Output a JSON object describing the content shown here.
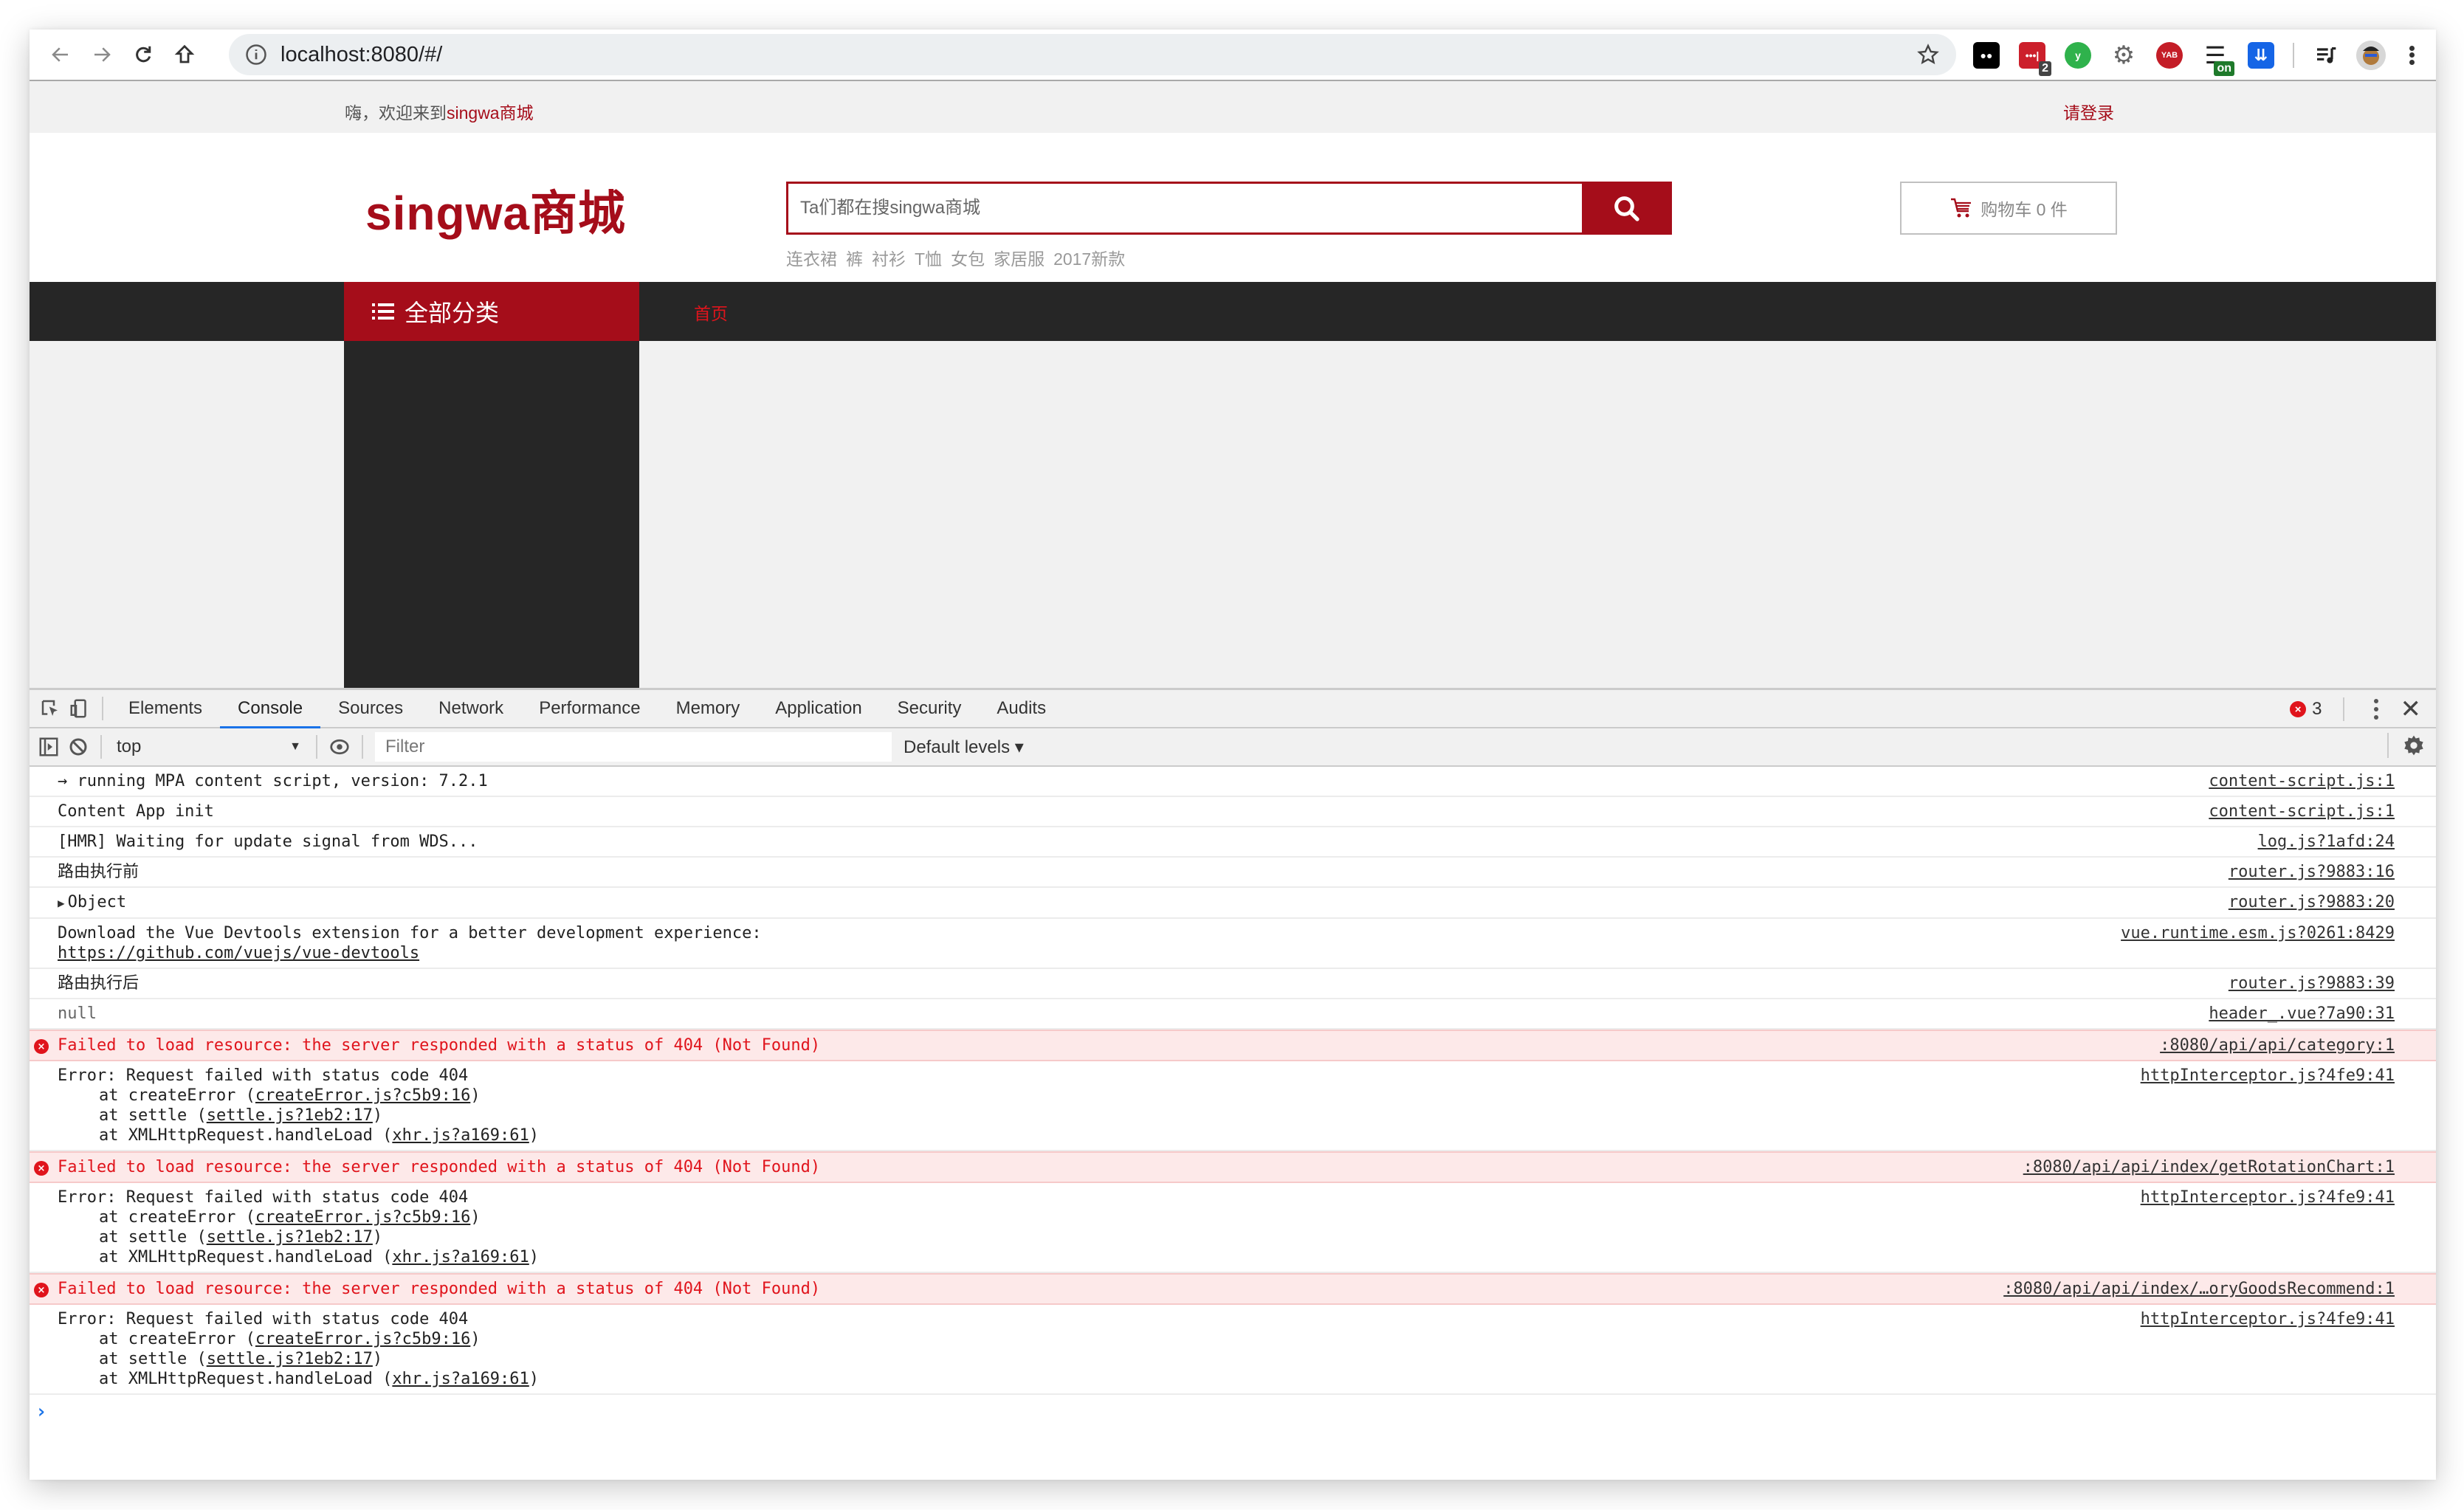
{
  "browser": {
    "url": "localhost:8080/#/",
    "nav_icons": [
      "back-icon",
      "forward-icon",
      "reload-icon",
      "home-icon"
    ],
    "extensions": [
      {
        "name": "tampermonkey-extension",
        "label": "●●",
        "color": "#000000"
      },
      {
        "name": "lastpass-extension",
        "label": "•••|",
        "color": "#cc1f2b",
        "badge": "2",
        "badge_color": "#444444"
      },
      {
        "name": "vimium-extension",
        "label": "y",
        "color": "#2fb24c"
      },
      {
        "name": "settings-gear-extension",
        "label": "⚙",
        "color": "#666666"
      },
      {
        "name": "yab-extension",
        "label": "YAB",
        "color": "#c41d27"
      },
      {
        "name": "list-extension",
        "label": "☰",
        "color": "#222222",
        "badge": "on",
        "badge_color": "#1f7a2b"
      },
      {
        "name": "save-extension",
        "label": "⇊",
        "color": "#1565e6"
      }
    ]
  },
  "site": {
    "welcome_prefix": "嗨，欢迎来到",
    "welcome_brand": "singwa商城",
    "login": "请登录",
    "logo": "singwa商城",
    "search_placeholder": "Ta们都在搜singwa商城",
    "hot_words": [
      "连衣裙",
      "裤",
      "衬衫",
      "T恤",
      "女包",
      "家居服",
      "2017新款"
    ],
    "cart_label": "购物车 0 件",
    "all_categories": "全部分类",
    "nav_home": "首页",
    "brand_color": "#a50d1a"
  },
  "devtools": {
    "tabs": [
      "Elements",
      "Console",
      "Sources",
      "Network",
      "Performance",
      "Memory",
      "Application",
      "Security",
      "Audits"
    ],
    "active_tab": "Console",
    "error_count": "3",
    "context": "top",
    "filter_placeholder": "Filter",
    "levels": "Default levels ▾",
    "logs": [
      {
        "type": "log",
        "text": "→ running MPA content script, version: 7.2.1",
        "source": "content-script.js:1"
      },
      {
        "type": "log",
        "text": "Content App init",
        "source": "content-script.js:1"
      },
      {
        "type": "log",
        "text": "[HMR] Waiting for update signal from WDS...",
        "source": "log.js?1afd:24"
      },
      {
        "type": "log",
        "text": "路由执行前",
        "source": "router.js?9883:16"
      },
      {
        "type": "object",
        "text": "Object",
        "source": "router.js?9883:20"
      },
      {
        "type": "log",
        "text": "Download the Vue Devtools extension for a better development experience:",
        "link": "https://github.com/vuejs/vue-devtools",
        "source": "vue.runtime.esm.js?0261:8429"
      },
      {
        "type": "log",
        "text": "路由执行后",
        "source": "router.js?9883:39"
      },
      {
        "type": "null",
        "text": "null",
        "source": "header_.vue?7a90:31"
      },
      {
        "type": "error",
        "text": "Failed to load resource: the server responded with a status of 404 (Not Found)",
        "source": ":8080/api/api/category:1"
      },
      {
        "type": "stack",
        "text": "Error: Request failed with status code 404",
        "source": "httpInterceptor.js?4fe9:41",
        "frames": [
          {
            "prefix": "at createError (",
            "link": "createError.js?c5b9:16",
            "suffix": ")"
          },
          {
            "prefix": "at settle (",
            "link": "settle.js?1eb2:17",
            "suffix": ")"
          },
          {
            "prefix": "at XMLHttpRequest.handleLoad (",
            "link": "xhr.js?a169:61",
            "suffix": ")"
          }
        ]
      },
      {
        "type": "error",
        "text": "Failed to load resource: the server responded with a status of 404 (Not Found)",
        "source": ":8080/api/api/index/getRotationChart:1"
      },
      {
        "type": "stack",
        "text": "Error: Request failed with status code 404",
        "source": "httpInterceptor.js?4fe9:41",
        "frames": [
          {
            "prefix": "at createError (",
            "link": "createError.js?c5b9:16",
            "suffix": ")"
          },
          {
            "prefix": "at settle (",
            "link": "settle.js?1eb2:17",
            "suffix": ")"
          },
          {
            "prefix": "at XMLHttpRequest.handleLoad (",
            "link": "xhr.js?a169:61",
            "suffix": ")"
          }
        ]
      },
      {
        "type": "error",
        "text": "Failed to load resource: the server responded with a status of 404 (Not Found)",
        "source": ":8080/api/api/index/…oryGoodsRecommend:1"
      },
      {
        "type": "stack",
        "text": "Error: Request failed with status code 404",
        "source": "httpInterceptor.js?4fe9:41",
        "frames": [
          {
            "prefix": "at createError (",
            "link": "createError.js?c5b9:16",
            "suffix": ")"
          },
          {
            "prefix": "at settle (",
            "link": "settle.js?1eb2:17",
            "suffix": ")"
          },
          {
            "prefix": "at XMLHttpRequest.handleLoad (",
            "link": "xhr.js?a169:61",
            "suffix": ")"
          }
        ]
      }
    ],
    "prompt": "›"
  }
}
